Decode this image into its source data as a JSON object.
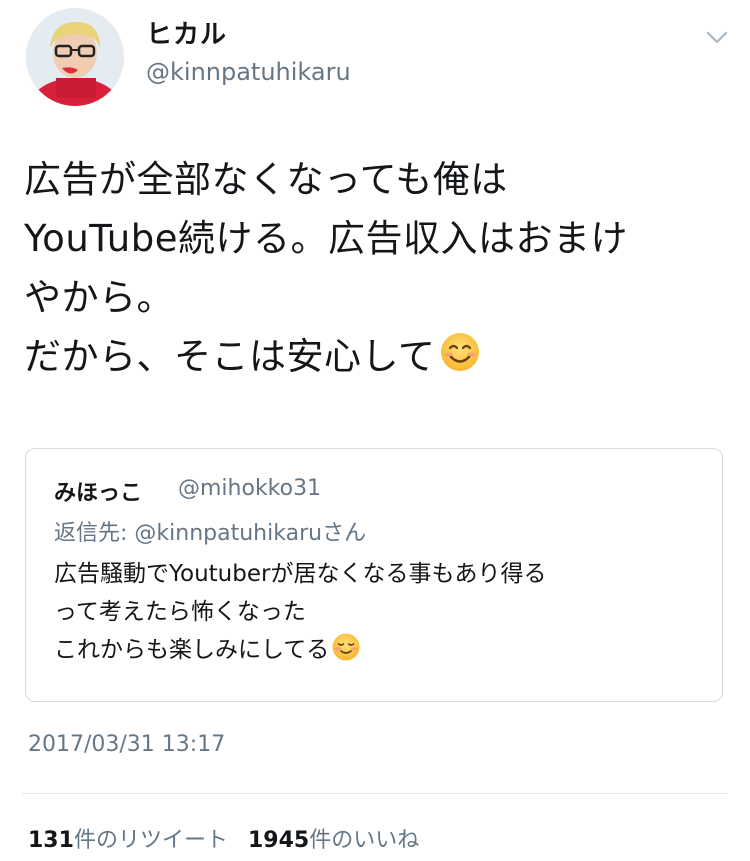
{
  "author": {
    "name": "ヒカル",
    "handle": "@kinnpatuhikaru"
  },
  "icons": {
    "menu": "chevron-down-icon",
    "tweet_emoji": "smiling-face-with-smiling-eyes-emoji",
    "quote_emoji": "smiling-face-emoji"
  },
  "tweet": {
    "lines": [
      "広告が全部なくなっても俺は",
      "YouTube続ける。広告収入はおまけ",
      "やから。",
      "だから、そこは安心して"
    ]
  },
  "quote": {
    "name": "みほっこ",
    "handle": "@mihokko31",
    "reply_prefix": "返信先:",
    "reply_to": "@kinnpatuhikaru",
    "reply_suffix": "さん",
    "lines": [
      "広告騒動でYoutuberが居なくなる事もあり得る",
      "って考えたら怖くなった",
      "これからも楽しみにしてる"
    ]
  },
  "timestamp": "2017/03/31 13:17",
  "stats": {
    "retweets_count": "131",
    "retweets_label": "件のリツイート",
    "likes_count": "1945",
    "likes_label": "件のいいね"
  },
  "colors": {
    "text": "#14171a",
    "secondary": "#657786",
    "border": "#d5dce2"
  }
}
